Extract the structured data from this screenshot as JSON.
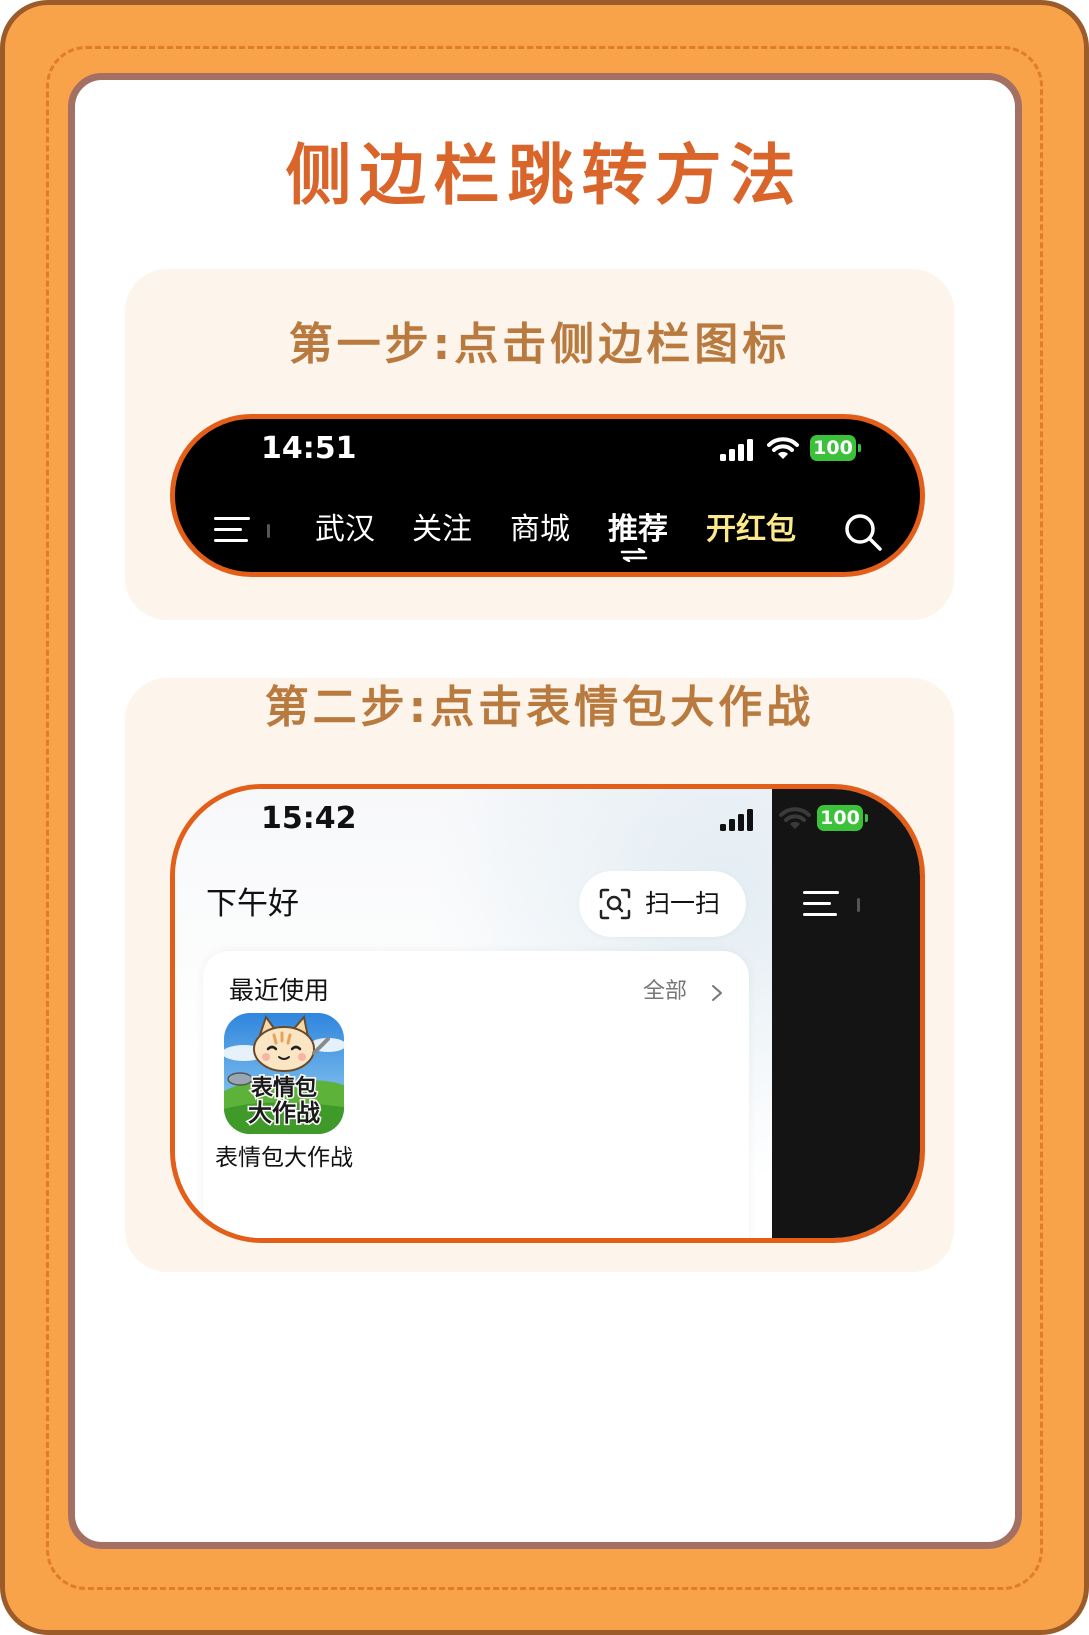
{
  "title": "侧边栏跳转方法",
  "colors": {
    "frame": "#F8A24A",
    "frame_border": "#9C5C2A",
    "panel_border": "#A47064",
    "title": "#D9652B",
    "card_bg": "#FDF5EC",
    "step_heading": "#B97A3F",
    "phone_outline": "#E35E18",
    "battery": "#3CC13B",
    "highlight_tab": "#FBE98B"
  },
  "steps": [
    {
      "heading": "第一步:点击侧边栏图标",
      "phone": {
        "time": "14:51",
        "battery": "100",
        "icons": [
          "signal-icon",
          "wifi-icon",
          "battery-icon",
          "menu-icon",
          "swap-icon",
          "search-icon"
        ],
        "nav_items": [
          "武汉",
          "关注",
          "商城",
          "推荐",
          "开红包"
        ],
        "active_item": "推荐",
        "highlight_item": "开红包"
      }
    },
    {
      "heading": "第二步:点击表情包大作战",
      "phone": {
        "time": "15:42",
        "battery": "100",
        "greeting": "下午好",
        "scan_label": "扫一扫",
        "icons": [
          "signal-icon",
          "wifi-icon",
          "battery-icon",
          "scan-icon",
          "menu-icon",
          "chevron-right-icon"
        ],
        "recent": {
          "title": "最近使用",
          "see_all": "全部",
          "apps": [
            {
              "name": "表情包大作战",
              "icon_text_line1": "表情包",
              "icon_text_line2": "大作战"
            }
          ]
        }
      }
    }
  ]
}
